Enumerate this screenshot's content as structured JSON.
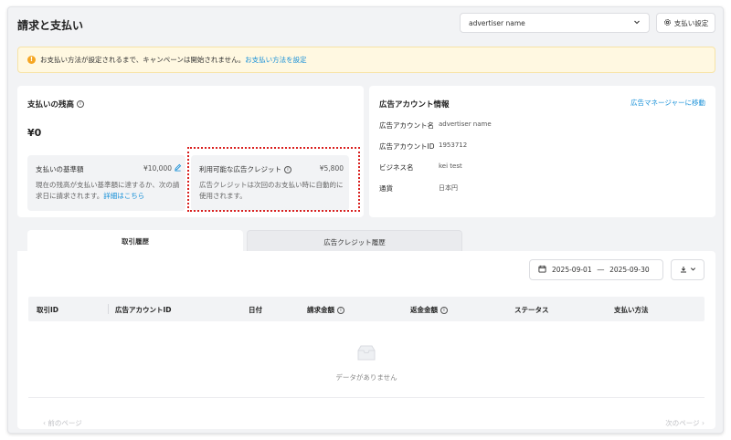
{
  "page": {
    "title": "請求と支払い"
  },
  "account_select": {
    "value": "advertiser name"
  },
  "payment_settings": {
    "label": "支払い設定"
  },
  "alert": {
    "text": "お支払い方法が設定されるまで、キャンペーンは開始されません。",
    "link": "お支払い方法を設定"
  },
  "balance": {
    "title": "支払いの残高",
    "amount": "¥0",
    "threshold": {
      "label": "支払いの基準額",
      "value": "¥10,000",
      "note": "現在の残高が支払い基準額に達するか、次の請求日に請求されます。",
      "link": "詳細はこちら"
    },
    "credit": {
      "label": "利用可能な広告クレジット",
      "value": "¥5,800",
      "note": "広告クレジットは次回のお支払い時に自動的に使用されます。"
    }
  },
  "account_info": {
    "title": "広告アカウント情報",
    "link": "広告マネージャーに移動",
    "rows": [
      {
        "label": "広告アカウント名",
        "value": "advertiser name"
      },
      {
        "label": "広告アカウントID",
        "value": "1953712"
      },
      {
        "label": "ビジネス名",
        "value": "kei test"
      },
      {
        "label": "通貨",
        "value": "日本円"
      }
    ]
  },
  "tabs": [
    {
      "label": "取引履歴"
    },
    {
      "label": "広告クレジット履歴"
    }
  ],
  "date_range": {
    "start": "2025-09-01",
    "separator": "―",
    "end": "2025-09-30"
  },
  "table": {
    "columns": [
      {
        "label": "取引ID"
      },
      {
        "label": "広告アカウントID"
      },
      {
        "label": "日付"
      },
      {
        "label": "請求金額"
      },
      {
        "label": "返金金額"
      },
      {
        "label": "ステータス"
      },
      {
        "label": "支払い方法"
      }
    ],
    "empty": "データがありません"
  },
  "pagination": {
    "prev": "前のページ",
    "next": "次のページ"
  },
  "colors": {
    "accent": "#1890d8",
    "highlight": "#d9201f",
    "warning": "#f5a623"
  },
  "icons": [
    "chevron-down-icon",
    "gear-icon",
    "warning-icon",
    "info-icon",
    "edit-icon",
    "calendar-icon",
    "download-icon",
    "empty-box-icon",
    "chevron-left-icon",
    "chevron-right-icon"
  ]
}
